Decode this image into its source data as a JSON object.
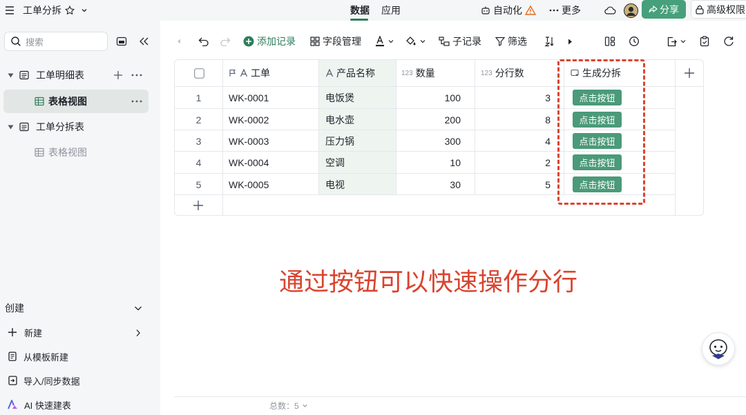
{
  "app": {
    "doc_title": "工单分拆",
    "center_tabs": [
      "数据",
      "应用"
    ],
    "automation_label": "自动化",
    "more_label": "更多",
    "share_label": "分享",
    "permission_label": "高级权限"
  },
  "sidebar": {
    "search_placeholder": "搜索",
    "tables": [
      {
        "label": "工单明细表",
        "view": "表格视图"
      },
      {
        "label": "工单分拆表",
        "view": "表格视图"
      }
    ],
    "create_label": "创建",
    "create_items": [
      {
        "label": "新建",
        "icon": "plus-icon"
      },
      {
        "label": "从模板新建",
        "icon": "template-icon"
      },
      {
        "label": "导入/同步数据",
        "icon": "import-icon"
      },
      {
        "label": "AI 快速建表",
        "icon": "ai-icon"
      }
    ]
  },
  "toolbar": {
    "add_record": "添加记录",
    "field_manage": "字段管理",
    "sub_record": "子记录",
    "filter": "筛选"
  },
  "grid": {
    "columns": [
      {
        "label": "工单",
        "type_hint": "A",
        "type": "text-primary"
      },
      {
        "label": "产品名称",
        "type_hint": "A",
        "type": "text"
      },
      {
        "label": "数量",
        "type_hint": "123",
        "type": "number"
      },
      {
        "label": "分行数",
        "type_hint": "123",
        "type": "number"
      },
      {
        "label": "生成分拆",
        "type": "button"
      }
    ],
    "rows": [
      {
        "index": "1",
        "order": "WK-0001",
        "product": "电饭煲",
        "qty": "100",
        "lines": "3",
        "button": "点击按钮"
      },
      {
        "index": "2",
        "order": "WK-0002",
        "product": "电水壶",
        "qty": "200",
        "lines": "8",
        "button": "点击按钮"
      },
      {
        "index": "3",
        "order": "WK-0003",
        "product": "压力锅",
        "qty": "300",
        "lines": "4",
        "button": "点击按钮"
      },
      {
        "index": "4",
        "order": "WK-0004",
        "product": "空调",
        "qty": "10",
        "lines": "2",
        "button": "点击按钮"
      },
      {
        "index": "5",
        "order": "WK-0005",
        "product": "电视",
        "qty": "30",
        "lines": "5",
        "button": "点击按钮"
      }
    ]
  },
  "caption": "通过按钮可以快速操作分行",
  "footer": {
    "total_label": "总数：5"
  },
  "colors": {
    "accent": "#46a07b",
    "button": "#4b9a79",
    "annotation": "#d9442f",
    "sidebar_bg": "#f5f6f7"
  }
}
